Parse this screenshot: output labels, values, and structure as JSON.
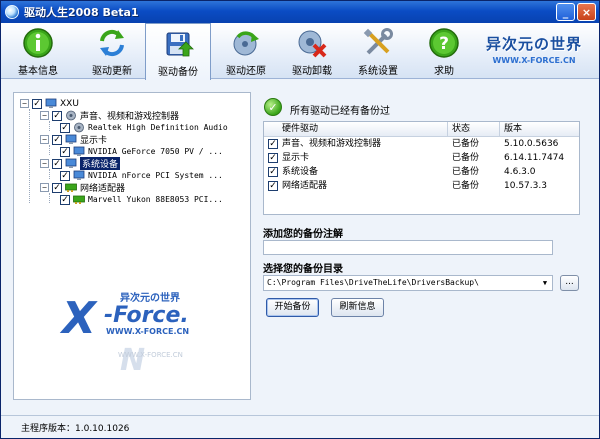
{
  "window": {
    "title": "驱动人生2008 Beta1"
  },
  "toolbar": {
    "items": [
      {
        "label": "基本信息",
        "icon": "info-icon"
      },
      {
        "label": "驱动更新",
        "icon": "refresh-icon"
      },
      {
        "label": "驱动备份",
        "icon": "backup-icon"
      },
      {
        "label": "驱动还原",
        "icon": "restore-icon"
      },
      {
        "label": "驱动卸载",
        "icon": "uninstall-icon"
      },
      {
        "label": "系统设置",
        "icon": "tools-icon"
      },
      {
        "label": "求助",
        "icon": "help-icon"
      }
    ],
    "active_index": 2,
    "brand_main": "异次元の世界",
    "brand_sub": "WWW.X-FORCE.CN"
  },
  "tree": {
    "root": "XXU",
    "nodes": [
      {
        "label": "声音、视频和游戏控制器",
        "children": [
          "Realtek High Definition Audio"
        ]
      },
      {
        "label": "显示卡",
        "children": [
          "NVIDIA GeForce 7050 PV / ..."
        ]
      },
      {
        "label": "系统设备",
        "children": [
          "NVIDIA nForce PCI System ..."
        ],
        "selected": true
      },
      {
        "label": "网络适配器",
        "children": [
          "Marvell Yukon 88E8053 PCI..."
        ]
      }
    ]
  },
  "watermark": {
    "logo_x": "X",
    "logo_force": "-Force.",
    "cn_text": "异次元の世界",
    "url": "WWW.X-FORCE.CN",
    "ghost_url": "WWW.X-FORCE.CN"
  },
  "status": {
    "message": "所有驱动已经有备份过"
  },
  "driver_table": {
    "headers": [
      "硬件驱动",
      "状态",
      "版本"
    ],
    "rows": [
      {
        "name": "声音、视频和游戏控制器",
        "status": "已备份",
        "version": "5.10.0.5636"
      },
      {
        "name": "显示卡",
        "status": "已备份",
        "version": "6.14.11.7474"
      },
      {
        "name": "系统设备",
        "status": "已备份",
        "version": "4.6.3.0"
      },
      {
        "name": "网络适配器",
        "status": "已备份",
        "version": "10.57.3.3"
      }
    ]
  },
  "backup_note": {
    "label": "添加您的备份注解",
    "value": ""
  },
  "backup_dir": {
    "label": "选择您的备份目录",
    "value": "C:\\Program Files\\DriveTheLife\\DriversBackup\\",
    "browse_label": "..."
  },
  "buttons": {
    "start_backup": "开始备份",
    "refresh_info": "刷新信息"
  },
  "statusbar": {
    "version_text": "主程序版本：1.0.10.1026"
  }
}
